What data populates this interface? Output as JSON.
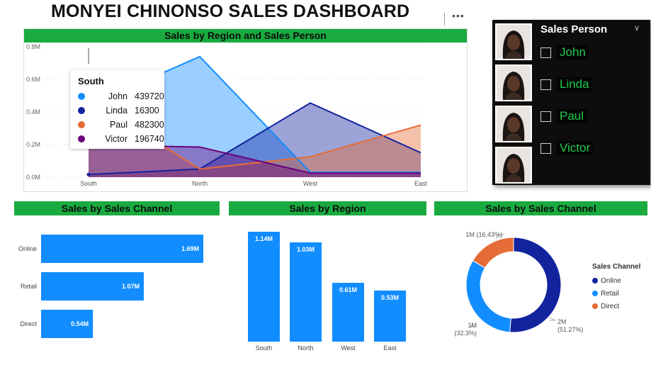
{
  "dashboard": {
    "title": "MONYEI CHINONSO SALES DASHBOARD",
    "more_options_icon": "more-options-icon"
  },
  "colors": {
    "banner_green": "#1aab40",
    "john": "#118dff",
    "linda": "#12239e",
    "paul": "#e66c37",
    "victor": "#6b007b",
    "bar_blue": "#118dff",
    "online": "#12239e",
    "retail": "#118dff",
    "direct": "#e66c37",
    "slicer_text": "#1ecb4a"
  },
  "tooltip": {
    "title": "South",
    "rows": [
      {
        "name": "John",
        "value": "439720",
        "color": "#118dff"
      },
      {
        "name": "Linda",
        "value": "16300",
        "color": "#12239e"
      },
      {
        "name": "Paul",
        "value": "482300",
        "color": "#e66c37"
      },
      {
        "name": "Victor",
        "value": "196740",
        "color": "#6b007b"
      }
    ]
  },
  "slicer": {
    "title": "Sales Person",
    "chevron_icon": "chevron-down-icon",
    "items": [
      {
        "label": "John"
      },
      {
        "label": "Linda"
      },
      {
        "label": "Paul"
      },
      {
        "label": "Victor"
      }
    ]
  },
  "chart_data": [
    {
      "id": "area",
      "type": "area",
      "title": "Sales by Region and Sales Person",
      "categories": [
        "South",
        "North",
        "West",
        "East"
      ],
      "ylim": [
        0,
        0.8
      ],
      "yticks": [
        0,
        0.2,
        0.4,
        0.6,
        0.8
      ],
      "ytick_labels": [
        "0.0M",
        "0.2M",
        "0.4M",
        "0.6M",
        "0.8M"
      ],
      "series": [
        {
          "name": "John",
          "values": [
            0.4397,
            0.74,
            0.03,
            0.03
          ],
          "color": "#118dff"
        },
        {
          "name": "Linda",
          "values": [
            0.0163,
            0.05,
            0.455,
            0.15
          ],
          "color": "#12239e"
        },
        {
          "name": "Paul",
          "values": [
            0.4823,
            0.05,
            0.125,
            0.32
          ],
          "color": "#e66c37"
        },
        {
          "name": "Victor",
          "values": [
            0.1967,
            0.185,
            0.025,
            0.025
          ],
          "color": "#6b007b"
        }
      ],
      "grid": true
    },
    {
      "id": "channel-bar",
      "type": "bar",
      "orientation": "horizontal",
      "title": "Sales by Sales Channel",
      "categories": [
        "Online",
        "Retail",
        "Direct"
      ],
      "values": [
        1.69,
        1.07,
        0.54
      ],
      "value_labels": [
        "1.69M",
        "1.07M",
        "0.54M"
      ],
      "color": "#118dff"
    },
    {
      "id": "region-bar",
      "type": "bar",
      "orientation": "vertical",
      "title": "Sales by Region",
      "categories": [
        "South",
        "North",
        "West",
        "East"
      ],
      "values": [
        1.14,
        1.03,
        0.61,
        0.53
      ],
      "value_labels": [
        "1.14M",
        "1.03M",
        "0.61M",
        "0.53M"
      ],
      "color": "#118dff"
    },
    {
      "id": "channel-donut",
      "type": "pie",
      "title": "Sales by Sales Channel",
      "categories": [
        "Online",
        "Retail",
        "Direct"
      ],
      "values": [
        51.27,
        32.3,
        16.43
      ],
      "labels": [
        "2M",
        "1M",
        "1M (16.43%)"
      ],
      "percent_labels": [
        "(51.27%)",
        "(32.3%)",
        ""
      ],
      "colors": [
        "#12239e",
        "#118dff",
        "#e66c37"
      ],
      "legend_title": "Sales Channel",
      "legend_position": "right"
    }
  ]
}
